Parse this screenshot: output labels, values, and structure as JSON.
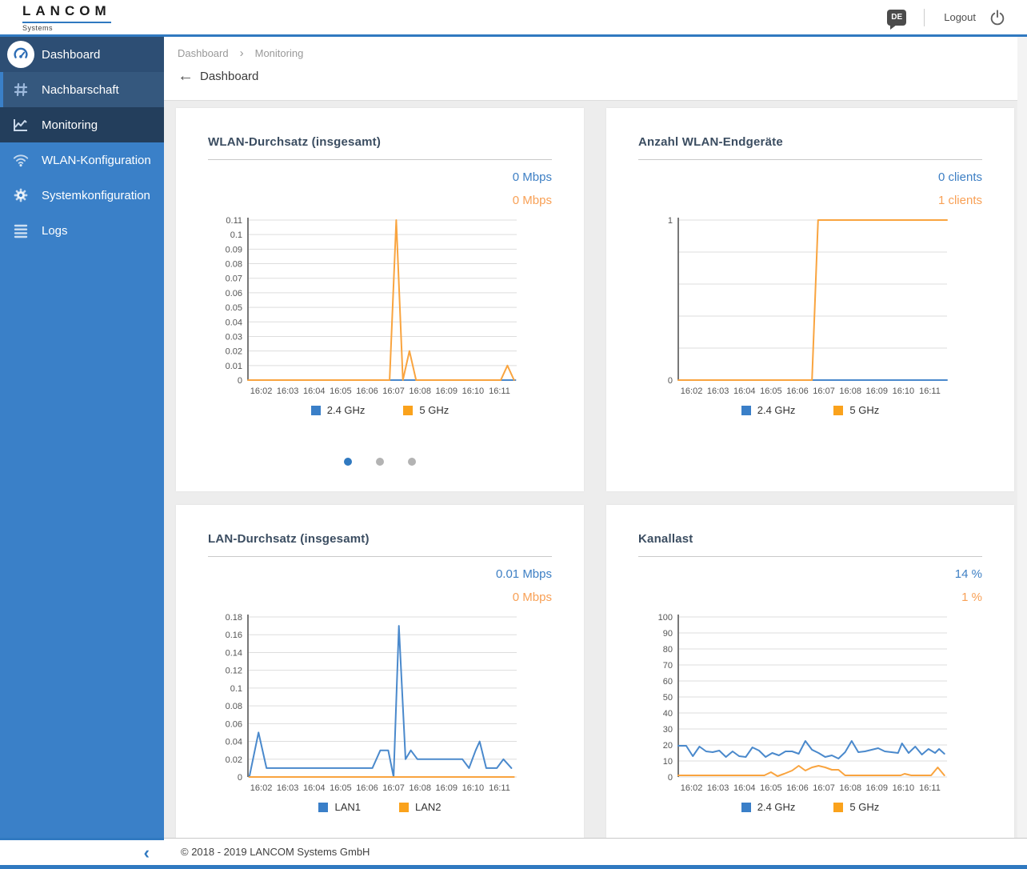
{
  "header": {
    "brand": "LANCOM",
    "brand_sub": "Systems",
    "lang_badge": "DE",
    "logout_label": "Logout"
  },
  "sidebar": {
    "items": [
      {
        "id": "dashboard",
        "label": "Dashboard",
        "icon": "gauge-icon",
        "state": "section-active"
      },
      {
        "id": "nachbarschaft",
        "label": "Nachbarschaft",
        "icon": "grid-icon",
        "state": "highlighted"
      },
      {
        "id": "monitoring",
        "label": "Monitoring",
        "icon": "chart-line-icon",
        "state": "active"
      },
      {
        "id": "wlan-konfiguration",
        "label": "WLAN-Konfiguration",
        "icon": "wifi-icon",
        "state": "default"
      },
      {
        "id": "systemkonfiguration",
        "label": "Systemkonfiguration",
        "icon": "gear-icon",
        "state": "default"
      },
      {
        "id": "logs",
        "label": "Logs",
        "icon": "list-icon",
        "state": "default"
      }
    ],
    "collapse_icon": "‹"
  },
  "breadcrumb": {
    "item1": "Dashboard",
    "separator": "›",
    "item2": "Monitoring"
  },
  "page_title": "Dashboard",
  "back_arrow": "←",
  "cards": [
    {
      "title": "WLAN-Durchsatz (insgesamt)",
      "value_primary": "0 Mbps",
      "value_secondary": "0 Mbps",
      "legend": [
        {
          "label": "2.4 GHz",
          "color": "#3a7fc8"
        },
        {
          "label": "5 GHz",
          "color": "#faa21c"
        }
      ],
      "dots": {
        "count": 3,
        "active_index": 0
      }
    },
    {
      "title": "Anzahl WLAN-Endgeräte",
      "value_primary": "0 clients",
      "value_secondary": "1 clients",
      "legend": [
        {
          "label": "2.4 GHz",
          "color": "#3a7fc8"
        },
        {
          "label": "5 GHz",
          "color": "#faa21c"
        }
      ]
    },
    {
      "title": "LAN-Durchsatz (insgesamt)",
      "value_primary": "0.01 Mbps",
      "value_secondary": "0 Mbps",
      "legend": [
        {
          "label": "LAN1",
          "color": "#3a7fc8"
        },
        {
          "label": "LAN2",
          "color": "#faa21c"
        }
      ]
    },
    {
      "title": "Kanallast",
      "value_primary": "14 %",
      "value_secondary": "1 %",
      "legend": [
        {
          "label": "2.4 GHz",
          "color": "#3a7fc8"
        },
        {
          "label": "5 GHz",
          "color": "#faa21c"
        }
      ]
    }
  ],
  "chart_data": [
    {
      "type": "line",
      "title": "WLAN-Durchsatz (insgesamt)",
      "unit": "Mbps",
      "x_range": [
        1.5,
        11.65
      ],
      "y_range": [
        0,
        0.11
      ],
      "grid": true,
      "x_ticks": [
        {
          "v": 2,
          "label": "16:02"
        },
        {
          "v": 3,
          "label": "16:03"
        },
        {
          "v": 4,
          "label": "16:04"
        },
        {
          "v": 5,
          "label": "16:05"
        },
        {
          "v": 6,
          "label": "16:06"
        },
        {
          "v": 7,
          "label": "16:07"
        },
        {
          "v": 8,
          "label": "16:08"
        },
        {
          "v": 9,
          "label": "16:09"
        },
        {
          "v": 10,
          "label": "16:10"
        },
        {
          "v": 11,
          "label": "16:11"
        }
      ],
      "y_ticks": [
        {
          "v": 0,
          "label": "0"
        },
        {
          "v": 0.01,
          "label": "0.01"
        },
        {
          "v": 0.02,
          "label": "0.02"
        },
        {
          "v": 0.03,
          "label": "0.03"
        },
        {
          "v": 0.04,
          "label": "0.04"
        },
        {
          "v": 0.05,
          "label": "0.05"
        },
        {
          "v": 0.06,
          "label": "0.06"
        },
        {
          "v": 0.07,
          "label": "0.07"
        },
        {
          "v": 0.08,
          "label": "0.08"
        },
        {
          "v": 0.09,
          "label": "0.09"
        },
        {
          "v": 0.1,
          "label": "0.1"
        },
        {
          "v": 0.11,
          "label": "0.11"
        }
      ],
      "series": [
        {
          "name": "2.4 GHz",
          "color": "#4a89cc",
          "points": [
            [
              1.5,
              0
            ],
            [
              11.6,
              0
            ]
          ]
        },
        {
          "name": "5 GHz",
          "color": "#f9a43f",
          "points": [
            [
              1.5,
              0
            ],
            [
              6.85,
              0
            ],
            [
              7.1,
              0.11
            ],
            [
              7.35,
              0
            ],
            [
              7.6,
              0.02
            ],
            [
              7.85,
              0
            ],
            [
              11.05,
              0
            ],
            [
              11.3,
              0.01
            ],
            [
              11.55,
              0
            ]
          ]
        }
      ]
    },
    {
      "type": "line",
      "title": "Anzahl WLAN-Endgeräte",
      "unit": "clients",
      "x_range": [
        1.5,
        11.65
      ],
      "y_range": [
        0,
        1
      ],
      "grid": true,
      "x_ticks": [
        {
          "v": 2,
          "label": "16:02"
        },
        {
          "v": 3,
          "label": "16:03"
        },
        {
          "v": 4,
          "label": "16:04"
        },
        {
          "v": 5,
          "label": "16:05"
        },
        {
          "v": 6,
          "label": "16:06"
        },
        {
          "v": 7,
          "label": "16:07"
        },
        {
          "v": 8,
          "label": "16:08"
        },
        {
          "v": 9,
          "label": "16:09"
        },
        {
          "v": 10,
          "label": "16:10"
        },
        {
          "v": 11,
          "label": "16:11"
        }
      ],
      "y_ticks": [
        {
          "v": 0,
          "label": "0"
        },
        {
          "v": 0.2,
          "label": ""
        },
        {
          "v": 0.4,
          "label": ""
        },
        {
          "v": 0.6,
          "label": ""
        },
        {
          "v": 0.8,
          "label": ""
        },
        {
          "v": 1,
          "label": "1"
        }
      ],
      "series": [
        {
          "name": "2.4 GHz",
          "color": "#4a89cc",
          "points": [
            [
              1.5,
              0
            ],
            [
              11.65,
              0
            ]
          ]
        },
        {
          "name": "5 GHz",
          "color": "#f9a43f",
          "points": [
            [
              1.5,
              0
            ],
            [
              6.55,
              0
            ],
            [
              6.78,
              1
            ],
            [
              11.65,
              1
            ]
          ]
        }
      ]
    },
    {
      "type": "line",
      "title": "LAN-Durchsatz (insgesamt)",
      "unit": "Mbps",
      "x_range": [
        1.5,
        11.65
      ],
      "y_range": [
        0,
        0.18
      ],
      "grid": true,
      "x_ticks": [
        {
          "v": 2,
          "label": "16:02"
        },
        {
          "v": 3,
          "label": "16:03"
        },
        {
          "v": 4,
          "label": "16:04"
        },
        {
          "v": 5,
          "label": "16:05"
        },
        {
          "v": 6,
          "label": "16:06"
        },
        {
          "v": 7,
          "label": "16:07"
        },
        {
          "v": 8,
          "label": "16:08"
        },
        {
          "v": 9,
          "label": "16:09"
        },
        {
          "v": 10,
          "label": "16:10"
        },
        {
          "v": 11,
          "label": "16:11"
        }
      ],
      "y_ticks": [
        {
          "v": 0,
          "label": "0"
        },
        {
          "v": 0.02,
          "label": "0.02"
        },
        {
          "v": 0.04,
          "label": "0.04"
        },
        {
          "v": 0.06,
          "label": "0.06"
        },
        {
          "v": 0.08,
          "label": "0.08"
        },
        {
          "v": 0.1,
          "label": "0.1"
        },
        {
          "v": 0.12,
          "label": "0.12"
        },
        {
          "v": 0.14,
          "label": "0.14"
        },
        {
          "v": 0.16,
          "label": "0.16"
        },
        {
          "v": 0.18,
          "label": "0.18"
        }
      ],
      "series": [
        {
          "name": "LAN1",
          "color": "#4a89cc",
          "points": [
            [
              1.55,
              0
            ],
            [
              1.9,
              0.05
            ],
            [
              2.2,
              0.01
            ],
            [
              6.2,
              0.01
            ],
            [
              6.5,
              0.03
            ],
            [
              6.8,
              0.03
            ],
            [
              7.0,
              0
            ],
            [
              7.2,
              0.17
            ],
            [
              7.45,
              0.02
            ],
            [
              7.65,
              0.03
            ],
            [
              7.9,
              0.02
            ],
            [
              9.6,
              0.02
            ],
            [
              9.85,
              0.01
            ],
            [
              10.1,
              0.03
            ],
            [
              10.25,
              0.04
            ],
            [
              10.5,
              0.01
            ],
            [
              10.9,
              0.01
            ],
            [
              11.15,
              0.02
            ],
            [
              11.45,
              0.01
            ]
          ]
        },
        {
          "name": "LAN2",
          "color": "#f9a43f",
          "points": [
            [
              1.55,
              0
            ],
            [
              11.55,
              0
            ]
          ]
        }
      ]
    },
    {
      "type": "line",
      "title": "Kanallast",
      "unit": "%",
      "x_range": [
        1.5,
        11.65
      ],
      "y_range": [
        0,
        100
      ],
      "grid": true,
      "x_ticks": [
        {
          "v": 2,
          "label": "16:02"
        },
        {
          "v": 3,
          "label": "16:03"
        },
        {
          "v": 4,
          "label": "16:04"
        },
        {
          "v": 5,
          "label": "16:05"
        },
        {
          "v": 6,
          "label": "16:06"
        },
        {
          "v": 7,
          "label": "16:07"
        },
        {
          "v": 8,
          "label": "16:08"
        },
        {
          "v": 9,
          "label": "16:09"
        },
        {
          "v": 10,
          "label": "16:10"
        },
        {
          "v": 11,
          "label": "16:11"
        }
      ],
      "y_ticks": [
        {
          "v": 0,
          "label": "0"
        },
        {
          "v": 10,
          "label": "10"
        },
        {
          "v": 20,
          "label": "20"
        },
        {
          "v": 30,
          "label": "30"
        },
        {
          "v": 40,
          "label": "40"
        },
        {
          "v": 50,
          "label": "50"
        },
        {
          "v": 60,
          "label": "60"
        },
        {
          "v": 70,
          "label": "70"
        },
        {
          "v": 80,
          "label": "80"
        },
        {
          "v": 90,
          "label": "90"
        },
        {
          "v": 100,
          "label": "100"
        }
      ],
      "series": [
        {
          "name": "2.4 GHz",
          "color": "#4a89cc",
          "points": [
            [
              1.5,
              19.5
            ],
            [
              1.8,
              19.5
            ],
            [
              2.05,
              13
            ],
            [
              2.3,
              19
            ],
            [
              2.55,
              16
            ],
            [
              2.8,
              15.5
            ],
            [
              3.05,
              16.5
            ],
            [
              3.3,
              12.5
            ],
            [
              3.55,
              16
            ],
            [
              3.8,
              13
            ],
            [
              4.05,
              12.5
            ],
            [
              4.3,
              18.5
            ],
            [
              4.55,
              16.5
            ],
            [
              4.8,
              12.5
            ],
            [
              5.05,
              15
            ],
            [
              5.3,
              13.5
            ],
            [
              5.55,
              16
            ],
            [
              5.8,
              16
            ],
            [
              6.05,
              14.5
            ],
            [
              6.3,
              22.5
            ],
            [
              6.55,
              17
            ],
            [
              6.8,
              15
            ],
            [
              7.05,
              12.5
            ],
            [
              7.3,
              13.5
            ],
            [
              7.55,
              11.5
            ],
            [
              7.8,
              15.5
            ],
            [
              8.05,
              22.5
            ],
            [
              8.3,
              15.5
            ],
            [
              8.55,
              16
            ],
            [
              8.8,
              17
            ],
            [
              9.05,
              18
            ],
            [
              9.3,
              16
            ],
            [
              9.55,
              15.5
            ],
            [
              9.8,
              15
            ],
            [
              9.95,
              21
            ],
            [
              10.2,
              15
            ],
            [
              10.45,
              19
            ],
            [
              10.7,
              14
            ],
            [
              10.95,
              17.5
            ],
            [
              11.2,
              15
            ],
            [
              11.35,
              17.5
            ],
            [
              11.55,
              14.5
            ]
          ]
        },
        {
          "name": "5 GHz",
          "color": "#f9a43f",
          "points": [
            [
              1.5,
              1
            ],
            [
              4.75,
              1
            ],
            [
              5.0,
              3
            ],
            [
              5.25,
              0.5
            ],
            [
              5.5,
              2
            ],
            [
              5.8,
              4
            ],
            [
              6.05,
              7
            ],
            [
              6.3,
              4
            ],
            [
              6.55,
              6
            ],
            [
              6.8,
              7
            ],
            [
              7.05,
              6
            ],
            [
              7.3,
              4.5
            ],
            [
              7.55,
              4.5
            ],
            [
              7.8,
              1
            ],
            [
              9.9,
              1
            ],
            [
              10.05,
              2
            ],
            [
              10.3,
              1
            ],
            [
              11.05,
              1
            ],
            [
              11.3,
              6
            ],
            [
              11.55,
              1
            ]
          ]
        }
      ]
    }
  ],
  "footer": {
    "copyright": "© 2018 - 2019 LANCOM Systems GmbH"
  },
  "colors": {
    "accent_blue": "#3079c0",
    "sidebar_base": "#3a80c8",
    "sidebar_item_dashboard": "#2d4e74",
    "sidebar_item_nachbarschaft": "#35587e",
    "sidebar_item_active": "#233e5c",
    "value_blue": "#3d7fc4",
    "value_orange": "#f8a055",
    "line_blue": "#4a89cc",
    "line_orange": "#f9a43f",
    "grid_line": "#dddddd",
    "content_bg": "#ededed"
  }
}
